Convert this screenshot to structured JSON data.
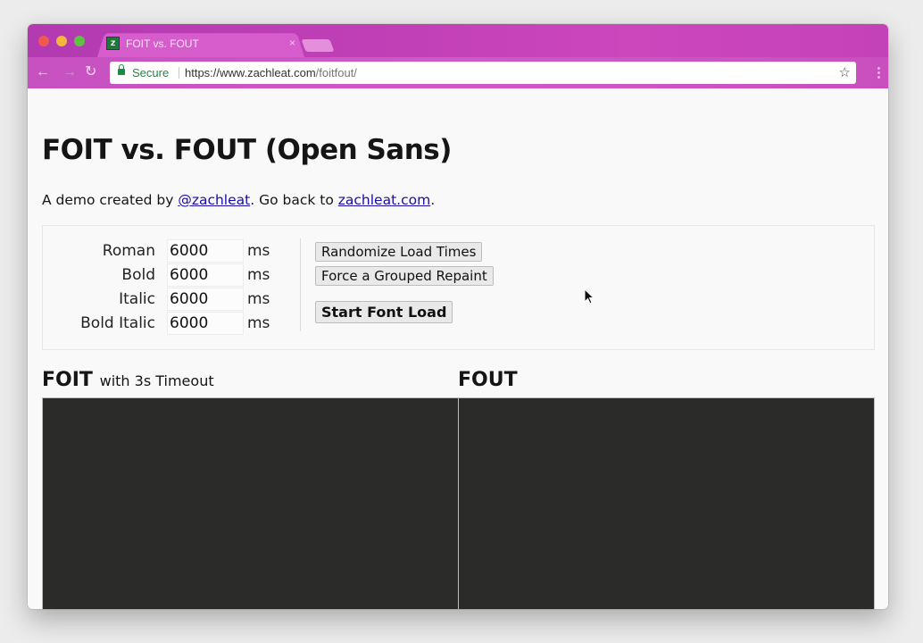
{
  "browser": {
    "tab_title": "FOIT vs. FOUT",
    "tab_favicon_letter": "z",
    "close_icon": "×",
    "back_icon": "←",
    "forward_icon": "→",
    "reload_icon": "↻",
    "security_label": "Secure",
    "url_host": "https://www.zachleat.com",
    "url_path": "/foitfout/",
    "star_icon": "☆",
    "menu_icon": "⋮",
    "accent_color": "#c443b9"
  },
  "page": {
    "title": "FOIT vs. FOUT (Open Sans)",
    "intro_prefix": "A demo created by ",
    "intro_link1": "@zachleat",
    "intro_middle": ". Go back to ",
    "intro_link2": "zachleat.com",
    "intro_suffix": "."
  },
  "controls": {
    "rows": [
      {
        "label": "Roman",
        "value": "6000",
        "unit": "ms"
      },
      {
        "label": "Bold",
        "value": "6000",
        "unit": "ms"
      },
      {
        "label": "Italic",
        "value": "6000",
        "unit": "ms"
      },
      {
        "label": "Bold Italic",
        "value": "6000",
        "unit": "ms"
      }
    ],
    "randomize_label": "Randomize Load Times",
    "repaint_label": "Force a Grouped Repaint",
    "start_label": "Start Font Load"
  },
  "demos": {
    "foit_title": "FOIT",
    "foit_subtitle": "with 3s Timeout",
    "fout_title": "FOUT"
  }
}
